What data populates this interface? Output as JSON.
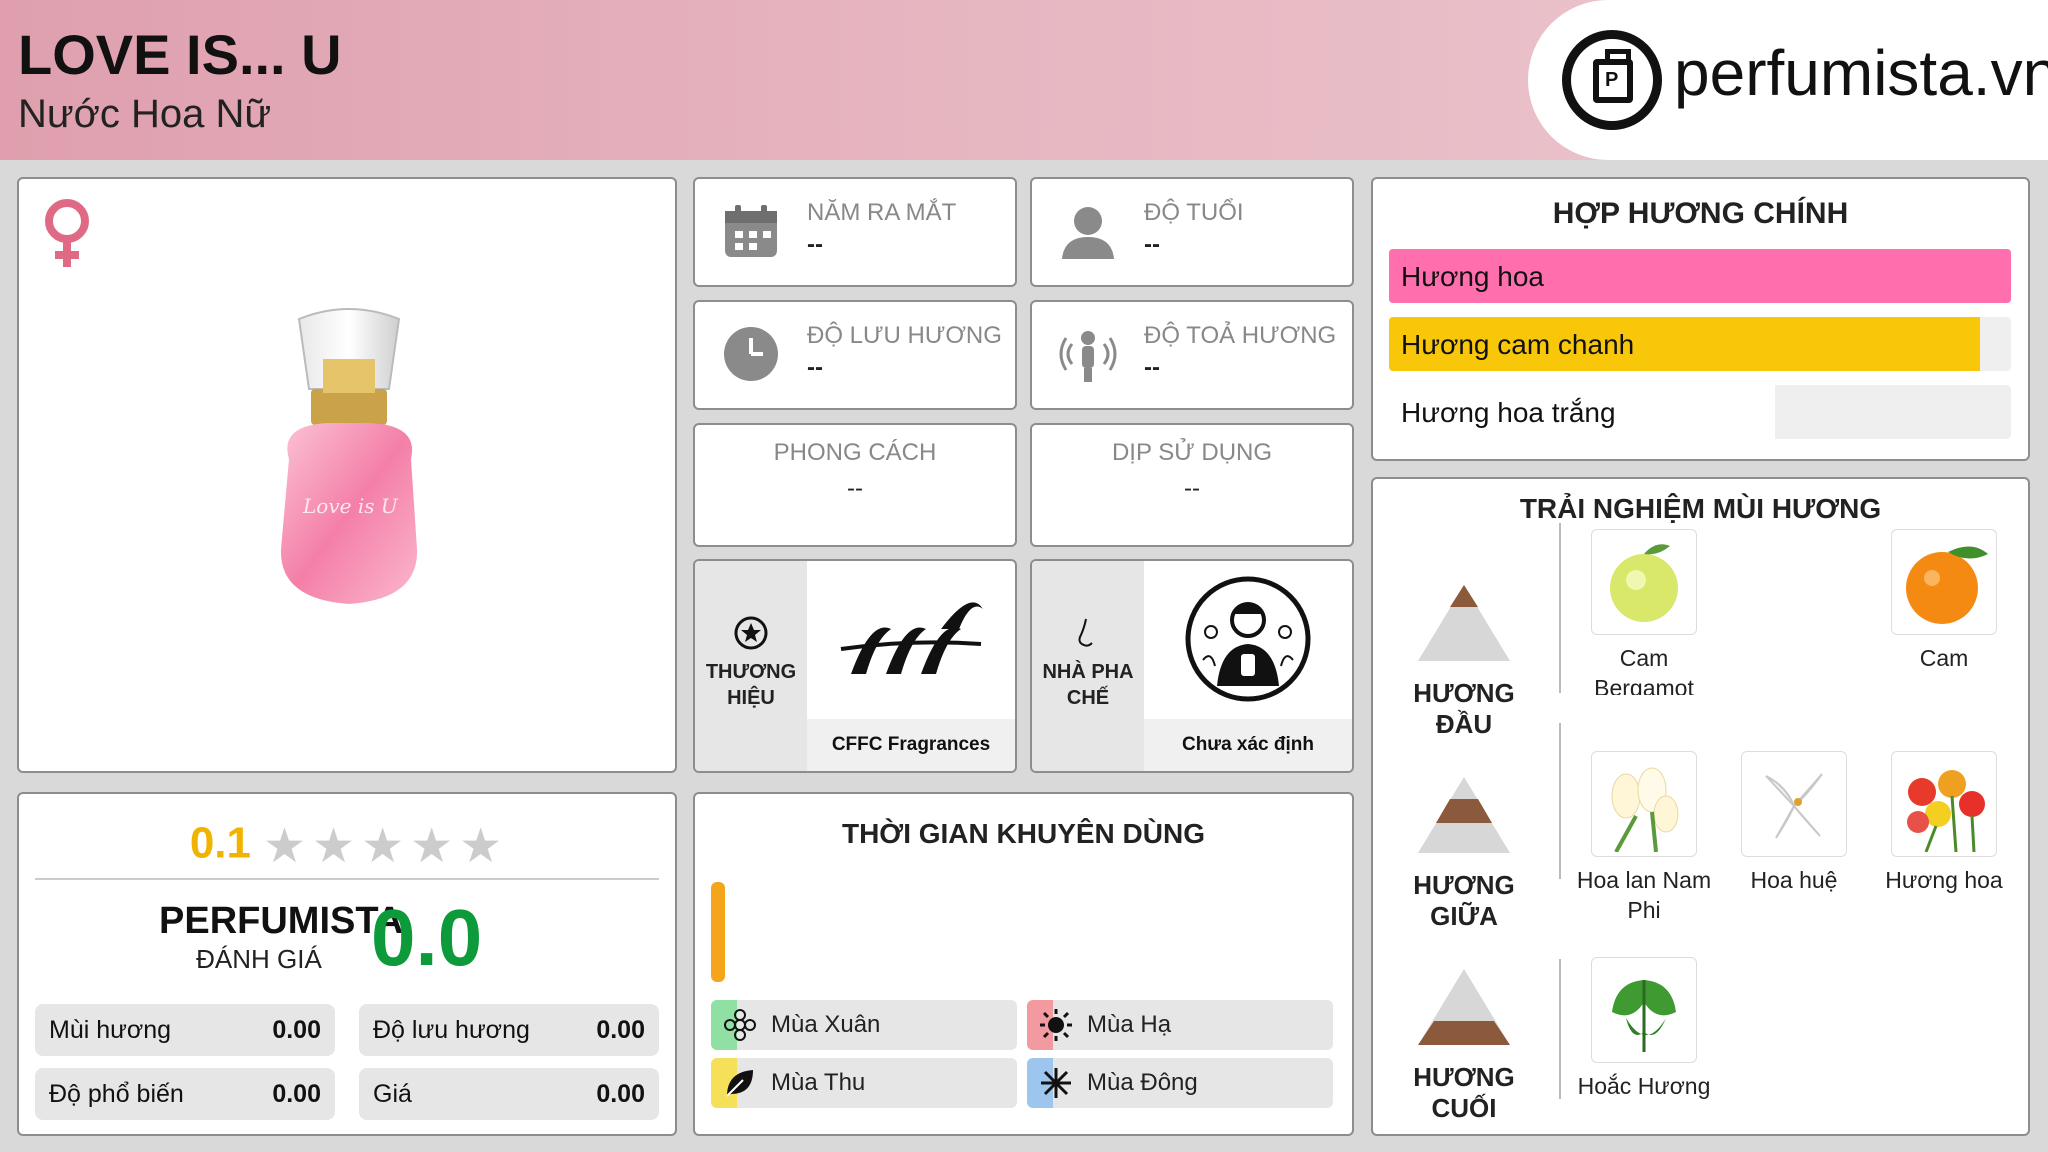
{
  "header": {
    "title": "LOVE IS... U",
    "subtitle": "Nước Hoa Nữ",
    "logo_text": "perfumista.vn"
  },
  "product": {
    "gender_icon": "female-symbol-icon",
    "bottle_label": "Love is U"
  },
  "rating": {
    "user_score": "0.1",
    "stars_filled": 0.1,
    "stars_total": 5,
    "perfumista_label": "PERFUMISTA",
    "perfumista_sub": "ĐÁNH GIÁ",
    "perfumista_score": "0.0",
    "metrics": [
      {
        "label": "Mùi hương",
        "value": "0.00"
      },
      {
        "label": "Độ lưu hương",
        "value": "0.00"
      },
      {
        "label": "Độ phổ biến",
        "value": "0.00"
      },
      {
        "label": "Giá",
        "value": "0.00"
      }
    ]
  },
  "info": {
    "release_year": {
      "label": "NĂM RA MẮT",
      "value": "--"
    },
    "age": {
      "label": "ĐỘ TUỔI",
      "value": "--"
    },
    "longevity": {
      "label": "ĐỘ LƯU HƯƠNG",
      "value": "--"
    },
    "sillage": {
      "label": "ĐỘ TOẢ HƯƠNG",
      "value": "--"
    },
    "style": {
      "label": "PHONG CÁCH",
      "value": "--"
    },
    "occasion": {
      "label": "DỊP SỬ DỤNG",
      "value": "--"
    },
    "brand": {
      "label": "THƯƠNG HIỆU",
      "name": "CFFC Fragrances"
    },
    "perfumer": {
      "label": "NHÀ PHA CHẾ",
      "name": "Chưa xác định"
    }
  },
  "usage_time": {
    "title": "THỜI GIAN KHUYÊN DÙNG",
    "bar_color": "#f5a51c",
    "seasons": [
      {
        "label": "Mùa Xuân",
        "color": "#8fe0a2",
        "icon": "flower-icon"
      },
      {
        "label": "Mùa Hạ",
        "color": "#f29aa0",
        "icon": "sun-icon"
      },
      {
        "label": "Mùa Thu",
        "color": "#f6e05a",
        "icon": "leaf-icon"
      },
      {
        "label": "Mùa Đông",
        "color": "#9cc6ee",
        "icon": "snowflake-icon"
      }
    ]
  },
  "accords": {
    "title": "HỢP HƯƠNG CHÍNH",
    "items": [
      {
        "label": "Hương hoa",
        "color": "#ff6fae",
        "level": 1.0
      },
      {
        "label": "Hương cam chanh",
        "color": "#f8c70a",
        "level": 0.95
      },
      {
        "label": "Hương hoa trắng",
        "color": "#ffffff",
        "level": 0.62
      }
    ]
  },
  "notes": {
    "title": "TRẢI NGHIỆM MÙI HƯƠNG",
    "top": {
      "label": "HƯƠNG ĐẦU",
      "items": [
        "Cam Bergamot vùng Calabria",
        "Cam"
      ]
    },
    "middle": {
      "label": "HƯƠNG GIỮA",
      "items": [
        "Hoa lan Nam Phi",
        "Hoa huệ",
        "Hương hoa"
      ]
    },
    "base": {
      "label": "HƯƠNG CUỐI",
      "items": [
        "Hoắc Hương"
      ]
    }
  }
}
